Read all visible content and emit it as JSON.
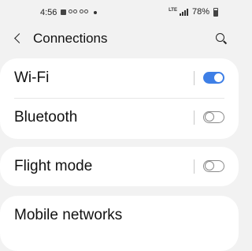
{
  "status_bar": {
    "time": "4:56",
    "network_type": "LTE",
    "battery_percent": "78%",
    "icons": [
      "image-icon",
      "voicemail-icon",
      "voicemail-icon",
      "notification-dot-icon",
      "signal-icon",
      "battery-icon"
    ]
  },
  "header": {
    "title": "Connections",
    "back_icon": "back-arrow-icon",
    "search_icon": "search-icon"
  },
  "settings": [
    {
      "label": "Wi-Fi",
      "toggle": true
    },
    {
      "label": "Bluetooth",
      "toggle": false
    },
    {
      "label": "Flight mode",
      "toggle": false
    },
    {
      "label": "Mobile networks"
    }
  ],
  "colors": {
    "toggle_on": "#3e7fe6",
    "background": "#f2f2f2",
    "card": "#ffffff"
  }
}
